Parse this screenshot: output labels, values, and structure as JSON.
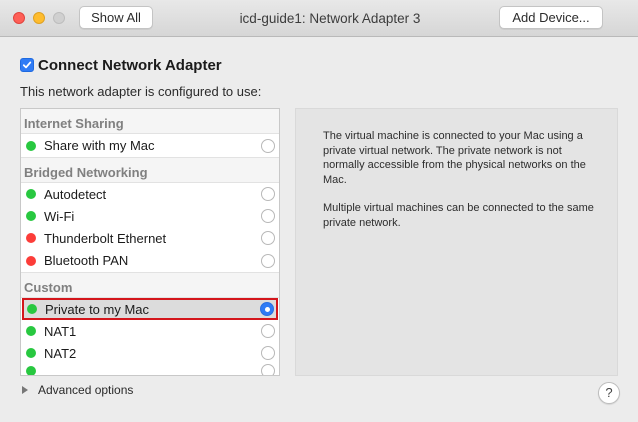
{
  "window": {
    "title": "icd-guide1: Network Adapter 3",
    "show_all_label": "Show All",
    "add_device_label": "Add Device..."
  },
  "adapter": {
    "connect_label": "Connect Network Adapter",
    "connected": true,
    "configured_label": "This network adapter is configured to use:"
  },
  "sections": {
    "internet_sharing": "Internet Sharing",
    "bridged": "Bridged Networking",
    "custom": "Custom"
  },
  "items": {
    "share_mac": {
      "label": "Share with my Mac",
      "status": "green"
    },
    "autodetect": {
      "label": "Autodetect",
      "status": "green"
    },
    "wifi": {
      "label": "Wi-Fi",
      "status": "green"
    },
    "thunderbolt": {
      "label": "Thunderbolt Ethernet",
      "status": "red"
    },
    "bluetooth": {
      "label": "Bluetooth PAN",
      "status": "red"
    },
    "private_mac": {
      "label": "Private to my Mac",
      "status": "green",
      "selected": true
    },
    "nat1": {
      "label": "NAT1",
      "status": "green"
    },
    "nat2": {
      "label": "NAT2",
      "status": "green"
    }
  },
  "description": {
    "para1": "The virtual machine is connected to your Mac using a private virtual network. The private network is not normally accessible from the physical networks on the Mac.",
    "para2": "Multiple virtual machines can be connected to the same private network."
  },
  "footer": {
    "advanced_label": "Advanced options",
    "help_label": "?"
  },
  "colors": {
    "accent": "#2f7bf5",
    "status_green": "#28c840",
    "status_red": "#fc3d39",
    "selection_outline": "#d4161c"
  }
}
